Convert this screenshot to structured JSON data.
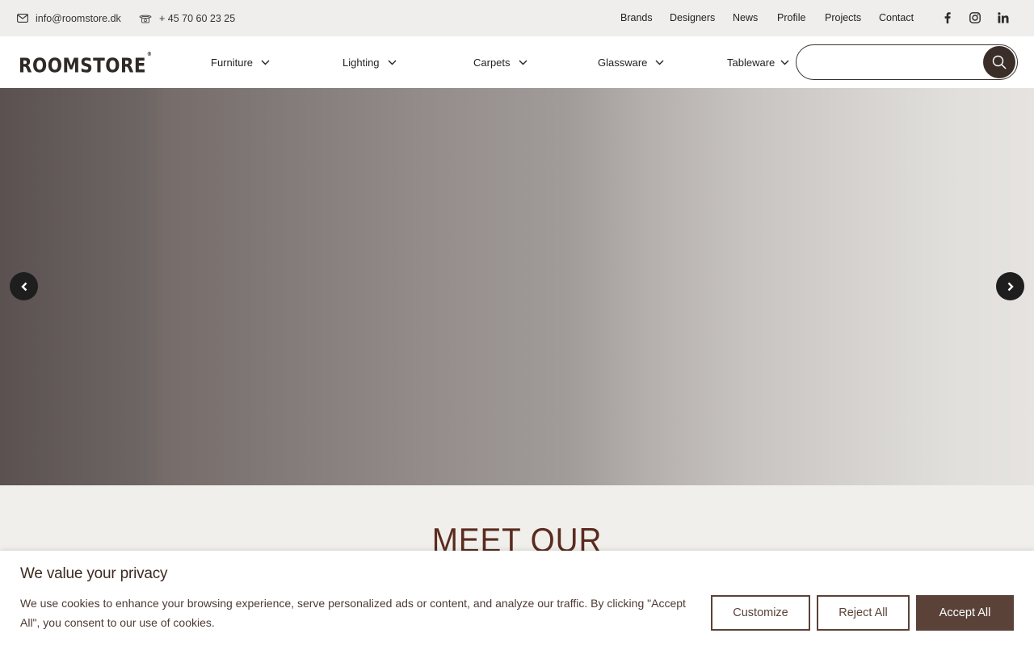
{
  "topbar": {
    "email": "info@roomstore.dk",
    "phone": "+ 45 70 60 23 25",
    "links": [
      "Brands",
      "Designers",
      "News",
      "Profile",
      "Projects",
      "Contact"
    ],
    "social_icons": [
      "facebook-icon",
      "instagram-icon",
      "linkedin-icon"
    ]
  },
  "header": {
    "logo": "ROOMSTORE",
    "logo_mark": "®",
    "nav": [
      "Furniture",
      "Lighting",
      "Carpets",
      "Glassware",
      "Tableware"
    ],
    "search_placeholder": ""
  },
  "hero": {
    "prev_icon": "chevron-left-icon",
    "next_icon": "chevron-right-icon"
  },
  "section": {
    "heading": "MEET OUR"
  },
  "cookie": {
    "title": "We value your privacy",
    "text": "We use cookies to enhance your browsing experience, serve personalized ads or content, and analyze our traffic. By clicking \"Accept All\", you consent to our use of cookies.",
    "customize": "Customize",
    "reject": "Reject All",
    "accept": "Accept All"
  },
  "colors": {
    "brand_brown": "#5a4238",
    "heading_brown": "#5a2b1f",
    "search_button": "#3b2e29"
  }
}
